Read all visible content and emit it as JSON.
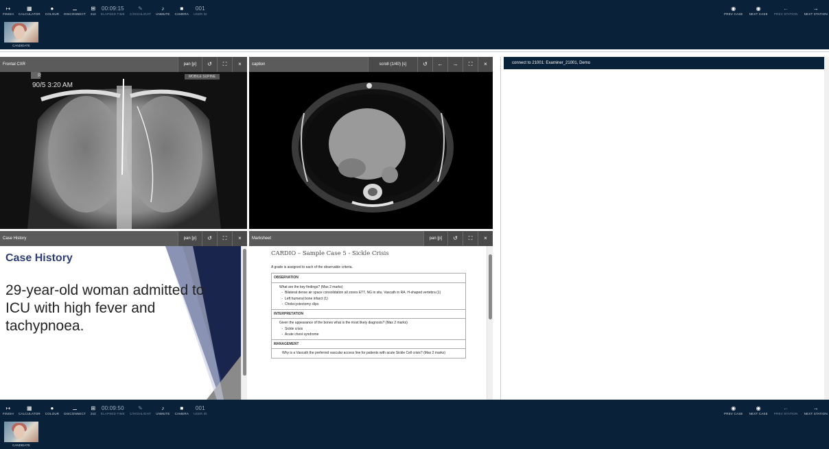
{
  "toolbar_top": {
    "tools": [
      {
        "icon": "exit-icon",
        "glyph": "↦",
        "label": "FINISH",
        "dim": false
      },
      {
        "icon": "calculator-icon",
        "glyph": "▦",
        "label": "CALCULATOR",
        "dim": false
      },
      {
        "icon": "palette-icon",
        "glyph": "●",
        "label": "COLOUR",
        "dim": false
      },
      {
        "icon": "disconnect-icon",
        "glyph": "⚊",
        "label": "DISCONNECT",
        "dim": false
      },
      {
        "icon": "grid-icon",
        "glyph": "⊞",
        "label": "2x2",
        "dim": false
      },
      {
        "icon": "timer",
        "glyph": "00:09:15",
        "label": "ELAPSED TIME",
        "dim": true,
        "big": true
      },
      {
        "icon": "pen-icon",
        "glyph": "✎",
        "label": "C/HIGHLIGHT",
        "dim": true
      },
      {
        "icon": "mic-off-icon",
        "glyph": "♪",
        "label": "UNMUTE",
        "dim": false
      },
      {
        "icon": "camera-icon",
        "glyph": "■",
        "label": "CAMERA",
        "dim": false
      },
      {
        "icon": "user-id",
        "glyph": "001",
        "label": "USER ID",
        "dim": true,
        "big": true
      }
    ],
    "nav": [
      {
        "icon": "prev-case-icon",
        "glyph": "◉",
        "label": "PREV CASE",
        "dim": false
      },
      {
        "icon": "next-case-icon",
        "glyph": "◉",
        "label": "NEXT CASE",
        "dim": false
      },
      {
        "icon": "arrow-left-icon",
        "glyph": "←",
        "label": "PREV STATION",
        "dim": true
      },
      {
        "icon": "arrow-right-icon",
        "glyph": "→",
        "label": "NEXT STATION",
        "dim": false
      }
    ],
    "camera_label": "CANDIDATE"
  },
  "toolbar_bottom": {
    "tools": [
      {
        "icon": "exit-icon",
        "glyph": "↦",
        "label": "FINISH",
        "dim": false
      },
      {
        "icon": "calculator-icon",
        "glyph": "▦",
        "label": "CALCULATOR",
        "dim": false
      },
      {
        "icon": "palette-icon",
        "glyph": "●",
        "label": "COLOUR",
        "dim": false
      },
      {
        "icon": "disconnect-icon",
        "glyph": "⚊",
        "label": "DISCONNECT",
        "dim": false
      },
      {
        "icon": "grid-icon",
        "glyph": "⊞",
        "label": "2x2",
        "dim": false
      },
      {
        "icon": "timer",
        "glyph": "00:09:50",
        "label": "ELAPSED TIME",
        "dim": true,
        "big": true
      },
      {
        "icon": "pen-icon",
        "glyph": "✎",
        "label": "C/HIGHLIGHT",
        "dim": true
      },
      {
        "icon": "mic-off-icon",
        "glyph": "♪",
        "label": "UNMUTE",
        "dim": false
      },
      {
        "icon": "camera-icon",
        "glyph": "■",
        "label": "CAMERA",
        "dim": false
      },
      {
        "icon": "user-id",
        "glyph": "001",
        "label": "USER ID",
        "dim": true,
        "big": true
      }
    ],
    "nav": [
      {
        "icon": "prev-case-icon",
        "glyph": "◉",
        "label": "PREV CASE",
        "dim": false
      },
      {
        "icon": "next-case-icon",
        "glyph": "◉",
        "label": "NEXT CASE",
        "dim": false
      },
      {
        "icon": "arrow-left-icon",
        "glyph": "←",
        "label": "PREV STATION",
        "dim": true
      },
      {
        "icon": "arrow-right-icon",
        "glyph": "→",
        "label": "NEXT STATION",
        "dim": false
      }
    ],
    "camera_label": "CANDIDATE"
  },
  "panes": {
    "cxr": {
      "title": "Frontal CXR",
      "control": "pan [p]",
      "image_tag": "MOBILE SUPINE",
      "image_stamp": "90/5 3:20 AM",
      "image_marker": "R"
    },
    "ct": {
      "title": "caption",
      "control": "scroll (1/40) [s]"
    },
    "case": {
      "title": "Case History",
      "control": "pan [p]"
    },
    "marksheet": {
      "title": "Marksheet",
      "control": "pan [p]"
    }
  },
  "case_history": {
    "heading": "Case History",
    "text": "29-year-old woman admitted to ICU with high fever and tachypnoea."
  },
  "marksheet": {
    "title": "CARDIO – Sample Case 5 - Sickle Crisis",
    "intro": "A grade is assigned to each of the observable criteria.",
    "obs_head": "OBSERVATION",
    "obs_q": "What are the key findings? (Max 2 marks)",
    "obs_items": [
      "Bilateral dense air space consolidation all zones ETT, NG in situ. Vascath in RA. H-shaped vertebra (1)",
      "Left humeral bone infarct (1)",
      "Cholecystectomy clips"
    ],
    "int_head": "INTERPRETATION",
    "int_q": "Given the appearance of the bones what is the most likely diagnosis? (Max 2 marks)",
    "int_items": [
      "Sickle crisis",
      "Acute chest syndrome"
    ],
    "mgmt_head": "MANAGEMENT",
    "mgmt_q": "Why is a Vascath the preferred vascular access line for patients with acute Sickle Cell crisis? (Max 2 marks)"
  },
  "right_panel": {
    "connection": "connect to 21001: Examiner_21001, Demo"
  },
  "colors": {
    "toolbar": "#0a2239",
    "pane_header": "#5b5b5b",
    "case_heading": "#2d3e74"
  }
}
